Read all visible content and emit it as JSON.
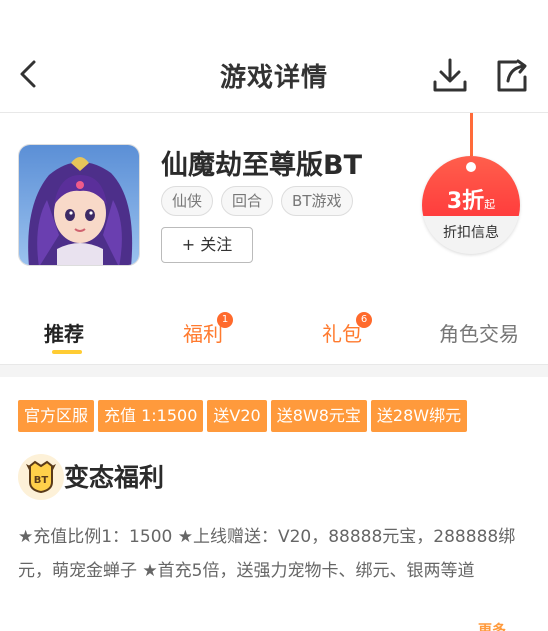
{
  "header": {
    "title": "游戏详情",
    "back_icon": "chevron-left-icon",
    "download_icon": "download-icon",
    "share_icon": "share-icon"
  },
  "game": {
    "name": "仙魔劫至尊版BT",
    "tags": [
      "仙侠",
      "回合",
      "BT游戏"
    ],
    "follow_label": "+ 关注"
  },
  "discount": {
    "value": "3折",
    "suffix": "起",
    "label": "折扣信息",
    "color": "#ff4b45"
  },
  "tabs": [
    {
      "label": "推荐",
      "badge": ""
    },
    {
      "label": "福利",
      "badge": "1"
    },
    {
      "label": "礼包",
      "badge": "6"
    },
    {
      "label": "角色交易",
      "badge": ""
    }
  ],
  "welfare": {
    "tags": [
      "官方区服",
      "充值 1:1500",
      "送V20",
      "送8W8元宝",
      "送28W绑元"
    ],
    "icon_text": "BT",
    "title": "变态福利",
    "description": "★充值比例1：1500 ★上线赠送：V20，88888元宝，288888绑元，萌宠金蝉子 ★首充5倍，送强力宠物卡、绑元、银两等道",
    "more_label": "更多"
  },
  "colors": {
    "accent": "#ff9a3c",
    "tab_active_underline": "#ffcc33",
    "tab_highlight": "#ff7a2e"
  }
}
